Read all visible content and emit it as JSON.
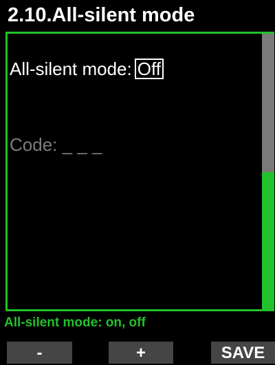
{
  "header": {
    "title": "2.10.All-silent mode"
  },
  "setting": {
    "label": "All-silent mode:",
    "value": "Off"
  },
  "code": {
    "label": "Code:",
    "value": "_ _ _"
  },
  "hint": "All-silent mode: on, off",
  "softkeys": {
    "left": "-",
    "middle": "+",
    "right": "SAVE"
  },
  "colors": {
    "accent": "#22c22a",
    "scrollbar_track": "#7a7a7a",
    "softkey_bg": "#454545",
    "dim_text": "#7d7d7d"
  }
}
